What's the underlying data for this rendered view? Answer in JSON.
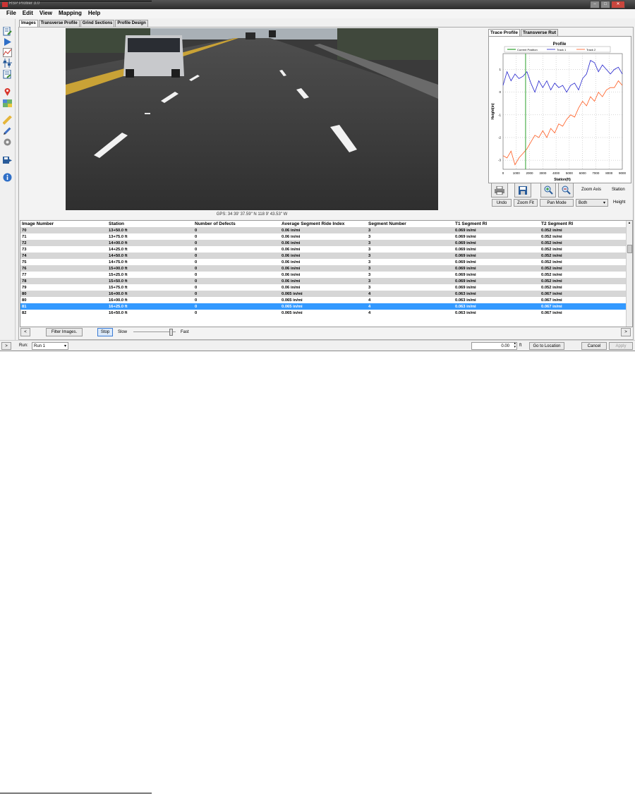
{
  "window": {
    "title": "RSP Profiler 3.0"
  },
  "menu": [
    "File",
    "Edit",
    "View",
    "Mapping",
    "Help"
  ],
  "toolbar_icons": [
    "report-icon",
    "play-icon",
    "chart-icon",
    "profile-settings-icon",
    "checklist-icon",
    "map-pin-icon",
    "map-icon",
    "ruler-icon",
    "pencil-icon",
    "gear-icon",
    "export-icon",
    "info-icon"
  ],
  "tabs": [
    "Images",
    "Transverse Profile",
    "Grind Sections",
    "Profile Design"
  ],
  "image_panel": {
    "gps": "GPS: 34 39' 37.59\" N 118 9' 43.53\" W"
  },
  "right_tabs": [
    "Trace Profile",
    "Transverse Rut"
  ],
  "chart_data": {
    "type": "line",
    "title": "Profile",
    "xlabel": "Station(ft)",
    "ylabel": "Height(in)",
    "xlim": [
      0,
      9000
    ],
    "ylim": [
      -3.4,
      1.7
    ],
    "xticks": [
      "0",
      "1000",
      "2000",
      "3000",
      "4000",
      "5000",
      "6000",
      "7000",
      "8000",
      "9000"
    ],
    "yticks": [
      "1",
      "0",
      "-1",
      "-2",
      "-3"
    ],
    "grid": true,
    "legend_position": "top",
    "legend": [
      "Current Position",
      "Track 1",
      "Track 2"
    ],
    "colors": {
      "current": "#2ca02c",
      "track1": "#2222cc",
      "track2": "#ff5a1f"
    },
    "current_position": 1700,
    "series": [
      {
        "name": "Track 1",
        "x": [
          0,
          300,
          600,
          900,
          1200,
          1500,
          1800,
          2100,
          2400,
          2700,
          3000,
          3300,
          3600,
          3900,
          4200,
          4500,
          4800,
          5100,
          5400,
          5700,
          6000,
          6300,
          6600,
          6900,
          7200,
          7500,
          7800,
          8100,
          8400,
          8700,
          9000
        ],
        "values": [
          0.3,
          0.9,
          0.5,
          0.8,
          0.6,
          0.7,
          0.9,
          0.4,
          0.0,
          0.5,
          0.2,
          0.5,
          0.1,
          0.4,
          0.2,
          0.3,
          0.0,
          0.3,
          0.4,
          0.1,
          0.6,
          0.8,
          1.4,
          1.3,
          0.9,
          1.2,
          1.0,
          0.8,
          1.0,
          1.1,
          0.8
        ]
      },
      {
        "name": "Track 2",
        "x": [
          0,
          300,
          600,
          900,
          1200,
          1500,
          1800,
          2100,
          2400,
          2700,
          3000,
          3300,
          3600,
          3900,
          4200,
          4500,
          4800,
          5100,
          5400,
          5700,
          6000,
          6300,
          6600,
          6900,
          7200,
          7500,
          7800,
          8100,
          8400,
          8700,
          9000
        ],
        "values": [
          -2.8,
          -2.9,
          -2.6,
          -3.2,
          -2.9,
          -2.7,
          -2.5,
          -2.2,
          -1.9,
          -2.0,
          -1.7,
          -2.0,
          -1.6,
          -1.8,
          -1.4,
          -1.5,
          -1.2,
          -1.0,
          -1.1,
          -0.7,
          -0.4,
          -0.6,
          -0.2,
          -0.4,
          0.0,
          -0.2,
          0.1,
          0.2,
          0.2,
          0.5,
          0.3
        ]
      }
    ]
  },
  "chart_controls": {
    "zoom_axis_label": "Zoom Axis",
    "station_label": "Station",
    "height_label": "Height",
    "undo": "Undo",
    "zoom_fit": "Zoom Fit",
    "pan_mode": "Pan Mode",
    "axis_select": "Both"
  },
  "table": {
    "columns": [
      "Image Number",
      "Station",
      "Number of Defects",
      "Average Segment Ride Index",
      "Segment Number",
      "T1 Segment RI",
      "T2 Segment RI"
    ],
    "rows": [
      [
        "70",
        "13+50.0 ft",
        "0",
        "0.06 in/mi",
        "3",
        "0.069 in/mi",
        "0.052 in/mi"
      ],
      [
        "71",
        "13+75.0 ft",
        "0",
        "0.06 in/mi",
        "3",
        "0.069 in/mi",
        "0.052 in/mi"
      ],
      [
        "72",
        "14+00.0 ft",
        "0",
        "0.06 in/mi",
        "3",
        "0.069 in/mi",
        "0.052 in/mi"
      ],
      [
        "73",
        "14+25.0 ft",
        "0",
        "0.06 in/mi",
        "3",
        "0.069 in/mi",
        "0.052 in/mi"
      ],
      [
        "74",
        "14+50.0 ft",
        "0",
        "0.06 in/mi",
        "3",
        "0.069 in/mi",
        "0.052 in/mi"
      ],
      [
        "75",
        "14+75.0 ft",
        "0",
        "0.06 in/mi",
        "3",
        "0.069 in/mi",
        "0.052 in/mi"
      ],
      [
        "76",
        "15+00.0 ft",
        "0",
        "0.06 in/mi",
        "3",
        "0.069 in/mi",
        "0.052 in/mi"
      ],
      [
        "77",
        "15+25.0 ft",
        "0",
        "0.06 in/mi",
        "3",
        "0.069 in/mi",
        "0.052 in/mi"
      ],
      [
        "78",
        "15+50.0 ft",
        "0",
        "0.06 in/mi",
        "3",
        "0.069 in/mi",
        "0.052 in/mi"
      ],
      [
        "79",
        "15+75.0 ft",
        "0",
        "0.06 in/mi",
        "3",
        "0.069 in/mi",
        "0.052 in/mi"
      ],
      [
        "80",
        "16+00.0 ft",
        "0",
        "0.065 in/mi",
        "4",
        "0.063 in/mi",
        "0.067 in/mi"
      ],
      [
        "80",
        "16+00.0 ft",
        "0",
        "0.065 in/mi",
        "4",
        "0.063 in/mi",
        "0.067 in/mi"
      ],
      [
        "81",
        "16+25.0 ft",
        "0",
        "0.065 in/mi",
        "4",
        "0.063 in/mi",
        "0.067 in/mi"
      ],
      [
        "82",
        "16+50.0 ft",
        "0",
        "0.065 in/mi",
        "4",
        "0.063 in/mi",
        "0.067 in/mi"
      ]
    ],
    "selected_row": 12
  },
  "playback": {
    "prev": "<",
    "next": ">",
    "filter": "Filter Images.",
    "stop": "Stop",
    "slow": "Slow",
    "fast": "Fast",
    "speed": 0.9
  },
  "bottom": {
    "expand": ">",
    "run_label": "Run:",
    "run_value": "Run 1",
    "location_value": "0.00",
    "unit": "ft",
    "go": "Go to Location",
    "cancel": "Cancel",
    "apply": "Apply"
  }
}
